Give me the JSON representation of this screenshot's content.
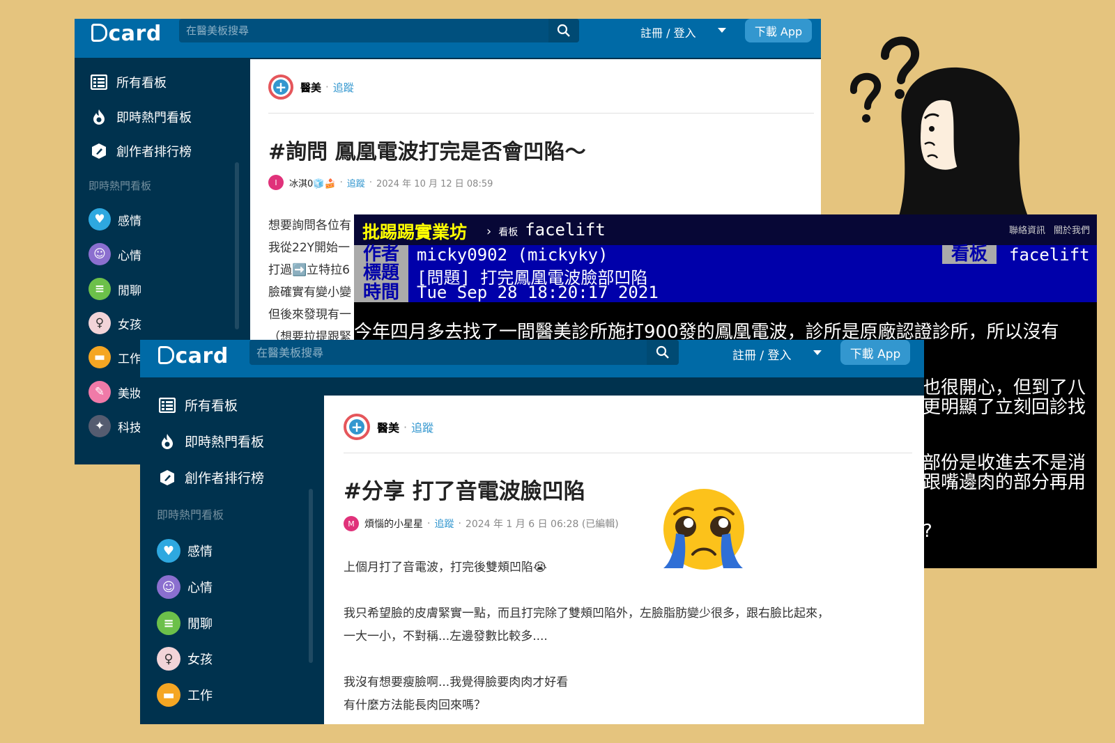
{
  "back_window": {
    "logo": "card",
    "search_placeholder": "在醫美板搜尋",
    "login": "註冊 / 登入",
    "app_button": "下載 App",
    "nav": [
      "所有看板",
      "即時熱門看板",
      "創作者排行榜"
    ],
    "section_head": "即時熱門看板",
    "boards": [
      "感情",
      "心情",
      "閒聊",
      "女孩",
      "工作",
      "美妝",
      "科技"
    ],
    "forum": "醫美",
    "dot": "·",
    "follow": "追蹤",
    "title": "#詢問 鳳凰電波打完是否會凹陷～",
    "author": "冰淇0🧊🍰",
    "author_initial": "I",
    "date": "2024 年 10 月 12 日 08:59",
    "body": [
      "想要詢問各位有",
      "我從22Y開始一",
      "打過➡️立特拉6",
      "臉確實有變小變",
      "但後來發現有一",
      "（想要拉提跟緊"
    ]
  },
  "ptt": {
    "brand": "批踢踢實業坊",
    "crumb_arrow": "›",
    "crumb_label": "看板",
    "crumb_board": "facelift",
    "links": [
      "聯絡資訊",
      "關於我們"
    ],
    "labels": [
      "作者",
      "標題",
      "時間"
    ],
    "values": [
      "micky0902 (mickyky)",
      "[問題] 打完鳳凰電波臉部凹陷",
      "Tue Sep 28 18:20:17 2021"
    ],
    "board_label": "看板",
    "board_value": "facelift",
    "lines": [
      "今年四月多去找了一間醫美診所施打900發的鳳凰電波，診所是原廠認證診所，所以沒有",
      "也很開心，但到了八",
      "更明顯了立刻回診找",
      "部份是收進去不是消",
      "跟嘴邊肉的部分再用",
      "?"
    ]
  },
  "front_window": {
    "logo": "card",
    "search_placeholder": "在醫美板搜尋",
    "login": "註冊 / 登入",
    "app_button": "下載 App",
    "nav": [
      "所有看板",
      "即時熱門看板",
      "創作者排行榜"
    ],
    "section_head": "即時熱門看板",
    "boards": [
      "感情",
      "心情",
      "閒聊",
      "女孩",
      "工作"
    ],
    "forum": "醫美",
    "dot": "·",
    "follow": "追蹤",
    "title": "#分享 打了音電波臉凹陷",
    "author": "煩惱的小星星",
    "author_initial": "M",
    "date": "2024 年 1 月 6 日 06:28 (已編輯)",
    "body": [
      "上個月打了音電波，打完後雙頰凹陷😭",
      "我只希望臉的皮膚緊實一點，而且打完除了雙頰凹陷外，左臉脂肪變少很多，跟右臉比起來，",
      "一大一小，不對稱...左邊發數比較多....",
      "我沒有想要瘦臉啊...我覺得臉要肉肉才好看",
      "有什麼方法能長肉回來嗎？"
    ]
  },
  "colors": {
    "background": "#E5C47E",
    "dcard_blue": "#006AA6",
    "dcard_dark": "#00324E",
    "ptt_header": "#0000AA",
    "ptt_brand": "#FFFF00"
  },
  "decorations": {
    "illustration": "question-marks-girl-icon",
    "emoji": "crying-face-icon"
  }
}
